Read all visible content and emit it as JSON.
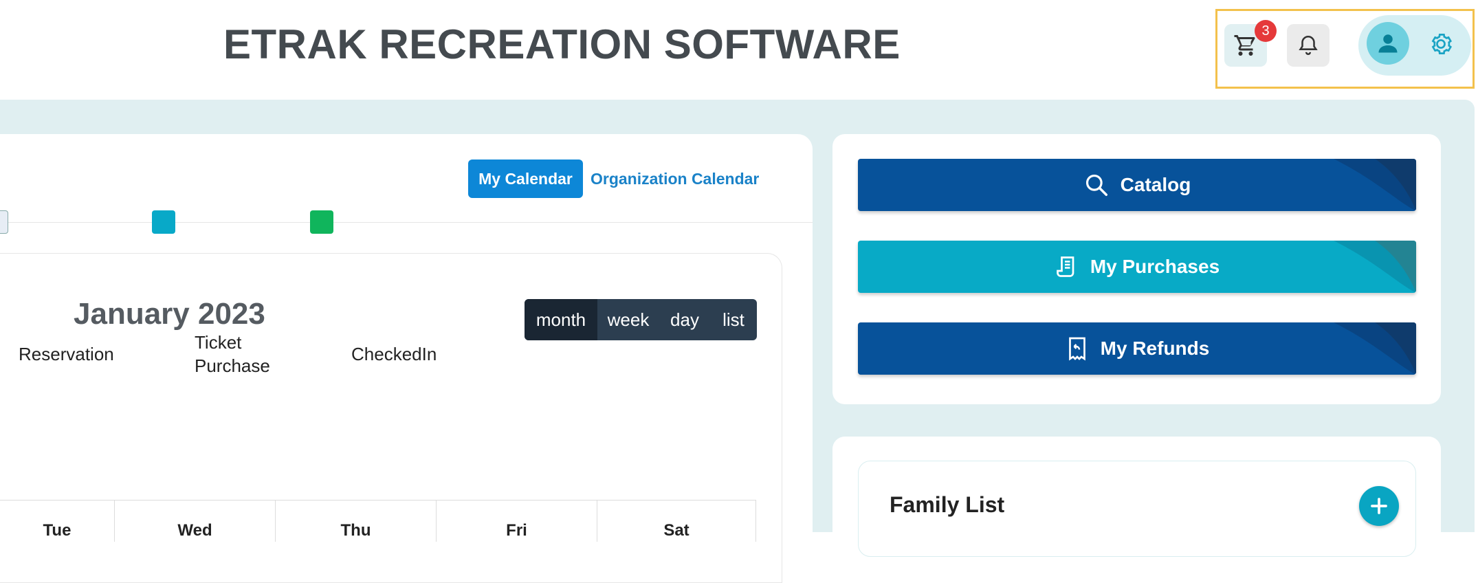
{
  "header": {
    "title": "ETRAK RECREATION SOFTWARE",
    "cart_badge": "3",
    "icons": {
      "cart": "shopping-cart-icon",
      "bell": "notification-bell-icon",
      "user": "user-avatar-icon",
      "settings": "gear-icon"
    }
  },
  "calendar": {
    "toggle": {
      "my_calendar": "My Calendar",
      "organization_calendar": "Organization Calendar"
    },
    "legend": [
      {
        "label": "Reservation",
        "color": "#e7edf5"
      },
      {
        "label": "Ticket Purchase",
        "color": "#08a9c8"
      },
      {
        "label": "CheckedIn",
        "color": "#10b55c"
      }
    ],
    "title": "January 2023",
    "views": [
      "month",
      "week",
      "day",
      "list"
    ],
    "active_view": "month",
    "day_headers": [
      "Tue",
      "Wed",
      "Thu",
      "Fri",
      "Sat"
    ]
  },
  "actions": {
    "catalog": "Catalog",
    "my_purchases": "My Purchases",
    "my_refunds": "My Refunds"
  },
  "family": {
    "title": "Family List"
  },
  "colors": {
    "brand_dark": "#07529a",
    "brand_teal": "#08aac6",
    "primary_blue": "#0d87d7",
    "content_bg": "#e0eff1",
    "highlight_border": "#f3c14c",
    "badge_red": "#e5393a"
  }
}
